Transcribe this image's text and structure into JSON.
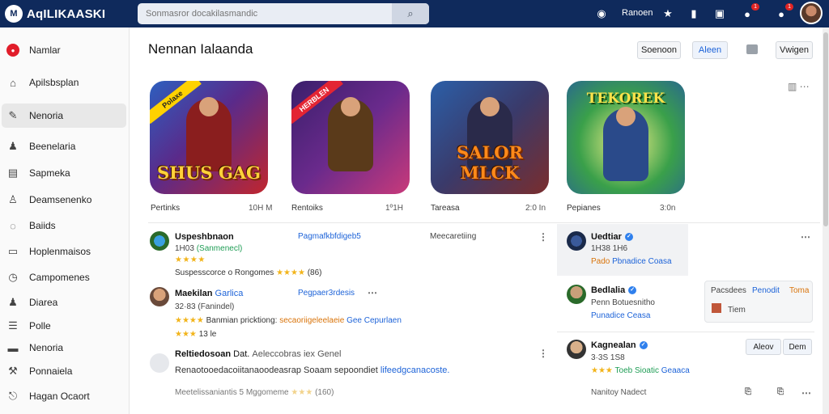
{
  "app": {
    "title": "AqILIKAASKI"
  },
  "search": {
    "placeholder": "Sonmasror docakilasmandic"
  },
  "topbar": {
    "label": "Ranoen",
    "notifications_1": "1",
    "notifications_2": "1"
  },
  "sidebar": {
    "items": [
      {
        "label": "Namlar",
        "icon": "app-red-icon"
      },
      {
        "label": "Apilsbsplan",
        "icon": "home-icon"
      },
      {
        "label": "Nenoria",
        "icon": "edit-icon",
        "active": true
      },
      {
        "label": "Beenelaria",
        "icon": "people-icon"
      },
      {
        "label": "Sapmeka",
        "icon": "window-icon"
      },
      {
        "label": "Deamsenenko",
        "icon": "user-icon"
      },
      {
        "label": "Baiids",
        "icon": "chat-icon"
      },
      {
        "label": "Hoplenmaisos",
        "icon": "comment-icon"
      },
      {
        "label": "Campomenes",
        "icon": "clock-icon"
      },
      {
        "label": "Diarea",
        "icon": "person-icon"
      },
      {
        "label": "Polle",
        "icon": "list-icon"
      },
      {
        "label": "Nenoria",
        "icon": "folder-icon"
      },
      {
        "label": "Ponnaiela",
        "icon": "tools-icon"
      },
      {
        "label": "Hagan Ocaort",
        "icon": "logout-icon"
      }
    ]
  },
  "main": {
    "title": "Nennan Ialaanda",
    "buttons": {
      "sort": "Soenoon",
      "adjust": "Aleen",
      "widget": "Vwigen"
    }
  },
  "games": [
    {
      "ribbon": "Polaxe",
      "art": "SHUS GAG",
      "label": "Pertinks",
      "count": "10H M",
      "colors": [
        "#2d5fbf",
        "#c1262d"
      ]
    },
    {
      "ribbon": "HERBLEN",
      "art": "",
      "label": "Rentoiks",
      "count": "1º1H",
      "colors": [
        "#3a1f6b",
        "#c93a7a"
      ]
    },
    {
      "ribbon": "",
      "art": "SALOR MLCK",
      "label": "Tareasa",
      "count": "2:0 In",
      "colors": [
        "#2b5fa8",
        "#7a2d2d"
      ]
    },
    {
      "ribbon": "",
      "art_top": "TEKOREK",
      "label": "Pepianes",
      "count": "3:0n",
      "colors": [
        "#3aa04a",
        "#2a6a8c"
      ]
    }
  ],
  "feed": [
    {
      "name": "Uspeshbnaon",
      "sub_num": "1H03",
      "sub_tag": "(Sanmenecl)",
      "link": "Pagmafkbfdigeb5",
      "note": "Meecaretiing",
      "stars": "★★★★",
      "text": "Suspesscorce o Rongomes",
      "rating": "★★★★",
      "count": "(86)"
    },
    {
      "name": "Maekilan",
      "tag": "Garlica",
      "sub_num": "32·83",
      "sub_tag": "(Fanindel)",
      "link": "Pegpaer3rdesis",
      "stars": "★★★★",
      "text": "Banmian pricktiong:",
      "extra": "secaoriigeleelaeie",
      "link2": "Gee Cepurlaen",
      "rating": "★★★",
      "count": "13 le"
    },
    {
      "name": "Reltiedosoan",
      "tag": "Dat.",
      "extra": "Aeleccobras iex Genel",
      "text": "Renaotooedacoiitanaoodeasrap Soaam sepoondiet",
      "link": "lifeedgcanacoste.",
      "footer": "Meetelissaniantis 5 Mggomeme",
      "rating": "★★★",
      "count": "(160)"
    }
  ],
  "right": [
    {
      "name": "Uedtiar",
      "sub_num": "1H38",
      "sub_num2": "1H6",
      "link": "Pbnadice",
      "tag": "Pado",
      "extra": "Coasa"
    },
    {
      "name": "Bedlalia",
      "sub_text": "Penn Botuesnitho",
      "link": "Punadice",
      "tag": "Ceasa"
    },
    {
      "name": "Kagnealan",
      "sub_num": "3·3S",
      "sub_num2": "1S8",
      "tag": "Toeb Sioatic",
      "extra": "Geaaca"
    }
  ],
  "popup": {
    "a": "Pacsdees",
    "b": "Penodit",
    "c": "Toma",
    "d": "Tiem"
  },
  "mini_buttons": {
    "follow": "Aleov",
    "done": "Dem"
  },
  "footer_right": "Nanitoy Nadect"
}
